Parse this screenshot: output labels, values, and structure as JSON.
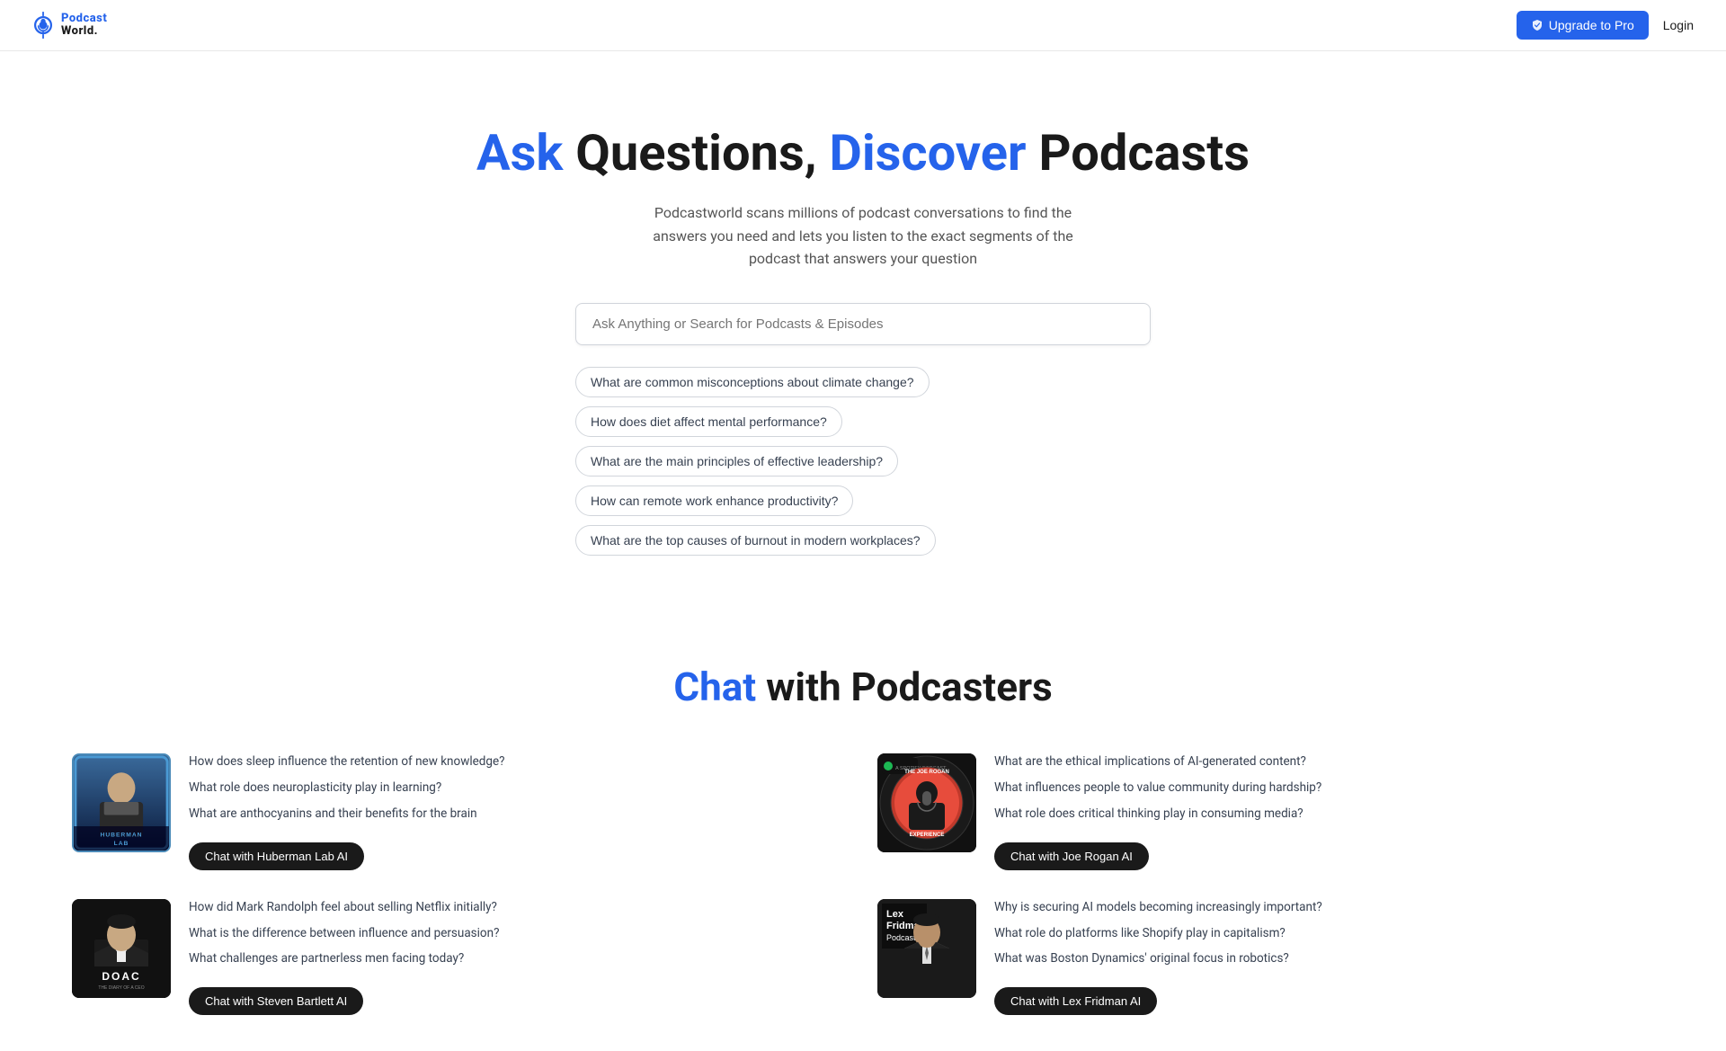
{
  "header": {
    "logo_line1": "Podcast",
    "logo_line2": "World.",
    "upgrade_label": "Upgrade to Pro",
    "login_label": "Login"
  },
  "hero": {
    "title_part1": "Ask",
    "title_part2": " Questions, ",
    "title_part3": "Discover",
    "title_part4": " Podcasts",
    "subtitle": "Podcastworld scans millions of podcast conversations to find the answers you need and lets you listen to the exact segments of the podcast that answers your question",
    "search_placeholder": "Ask Anything or Search for Podcasts & Episodes",
    "suggestions": [
      "What are common misconceptions about climate change?",
      "How does diet affect mental performance?",
      "What are the main principles of effective leadership?",
      "How can remote work enhance productivity?",
      "What are the top causes of burnout in modern workplaces?"
    ]
  },
  "chat_section": {
    "title_part1": "Chat",
    "title_part2": " with Podcasters",
    "podcasts": [
      {
        "id": "huberman",
        "name": "Huberman Lab",
        "thumb_label": "HUBERMAN\nLAB",
        "questions": [
          "How does sleep influence the retention of new knowledge?",
          "What role does neuroplasticity play in learning?",
          "What are anthocyanins and their benefits for the brain"
        ],
        "cta": "Chat with Huberman Lab AI"
      },
      {
        "id": "jre",
        "name": "The Joe Rogan Experience",
        "thumb_label": "THE JOE ROGAN EXPERIENCE",
        "questions": [
          "What are the ethical implications of AI-generated content?",
          "What influences people to value community during hardship?",
          "What role does critical thinking play in consuming media?"
        ],
        "cta": "Chat with Joe Rogan AI"
      },
      {
        "id": "doac",
        "name": "Diary of a CEO",
        "thumb_label": "DOAC\nTHE DIARY OF A CEO",
        "questions": [
          "How did Mark Randolph feel about selling Netflix initially?",
          "What is the difference between influence and persuasion?",
          "What challenges are partnerless men facing today?"
        ],
        "cta": "Chat with Steven Bartlett AI"
      },
      {
        "id": "lex",
        "name": "Lex Fridman Podcast",
        "thumb_label": "Lex\nFridman\nPodcast",
        "questions": [
          "Why is securing AI models becoming increasingly important?",
          "What role do platforms like Shopify play in capitalism?",
          "What was Boston Dynamics' original focus in robotics?"
        ],
        "cta": "Chat with Lex Fridman AI"
      }
    ]
  }
}
